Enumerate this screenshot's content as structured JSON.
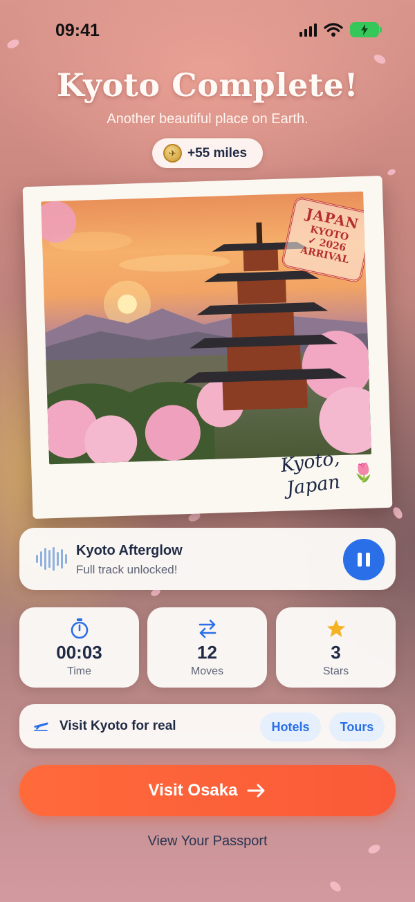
{
  "status_bar": {
    "time": "09:41"
  },
  "header": {
    "title": "Kyoto Complete!",
    "subtitle": "Another beautiful place on Earth.",
    "miles": "+55 miles"
  },
  "postcard": {
    "stamp_line1": "JAPAN",
    "stamp_line2": "KYOTO",
    "stamp_line3": "✓ 2026",
    "stamp_line4": "ARRIVAL",
    "caption_line1": "Kyoto,",
    "caption_line2": "Japan"
  },
  "music": {
    "track_name": "Kyoto Afterglow",
    "status": "Full track unlocked!"
  },
  "stats": [
    {
      "value": "00:03",
      "label": "Time",
      "icon": "stopwatch-icon"
    },
    {
      "value": "12",
      "label": "Moves",
      "icon": "swap-arrows-icon"
    },
    {
      "value": "3",
      "label": "Stars",
      "icon": "star-icon"
    }
  ],
  "visit_real": {
    "label": "Visit Kyoto for real",
    "hotels": "Hotels",
    "tours": "Tours"
  },
  "cta": {
    "label": "Visit Osaka"
  },
  "passport_link": "View Your Passport",
  "colors": {
    "accent": "#2a6fe8",
    "cta": "#fa5a38",
    "star": "#f4b324",
    "stamp": "#c23b3b"
  }
}
